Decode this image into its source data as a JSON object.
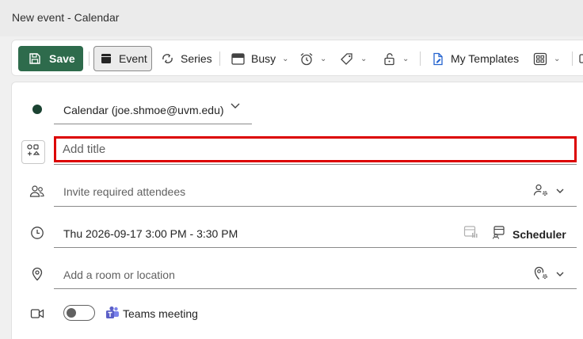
{
  "window": {
    "title": "New event - Calendar"
  },
  "toolbar": {
    "save_label": "Save",
    "event_label": "Event",
    "series_label": "Series",
    "busy_label": "Busy",
    "templates_label": "My Templates"
  },
  "form": {
    "calendar": {
      "label": "Calendar (joe.shmoe@uvm.edu)",
      "dot_color": "#1b4332"
    },
    "title": {
      "placeholder": "Add title"
    },
    "attendees": {
      "placeholder": "Invite required attendees"
    },
    "datetime": {
      "value": "Thu 2026-09-17 3:00 PM - 3:30 PM",
      "scheduler_label": "Scheduler"
    },
    "location": {
      "placeholder": "Add a room or location"
    },
    "teams": {
      "label": "Teams meeting",
      "enabled": false
    }
  },
  "colors": {
    "save_bg": "#2e6b4c",
    "title_border": "#dc0000",
    "teams_purple": "#5b5fc7"
  }
}
